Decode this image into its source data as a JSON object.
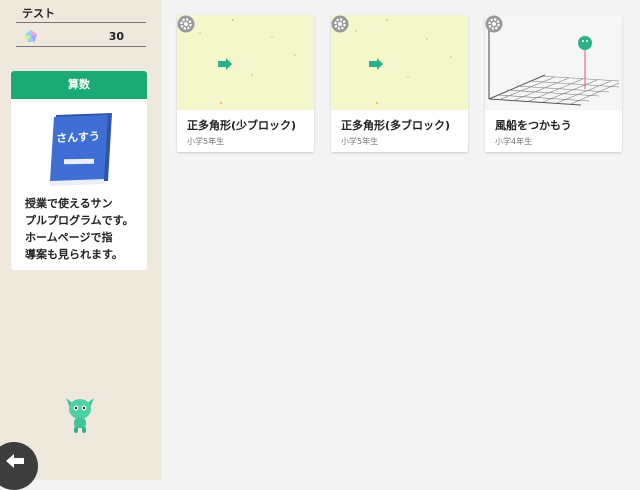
{
  "user": {
    "name": "テスト",
    "score": "30"
  },
  "subject": {
    "title": "算数",
    "book_label": "さんすう",
    "description_lines": [
      "授業で使えるサン",
      "プルプログラムです。",
      "ホームページで指",
      "導案も見られます。"
    ]
  },
  "cards": [
    {
      "title": "正多角形(少ブロック)",
      "grade": "小学5年生"
    },
    {
      "title": "正多角形(多ブロック)",
      "grade": "小学5年生"
    },
    {
      "title": "風船をつかもう",
      "grade": "小学4年生"
    }
  ],
  "colors": {
    "accent": "#1aab74",
    "sidebar_bg": "#efe8dc",
    "thumb_bg": "#f4f7cc",
    "book_blue": "#3f6fd4",
    "balloon": "#2cb089"
  },
  "icons": {
    "back": "arrow-left-icon",
    "settings": "gear-icon",
    "score": "gem-icon"
  }
}
